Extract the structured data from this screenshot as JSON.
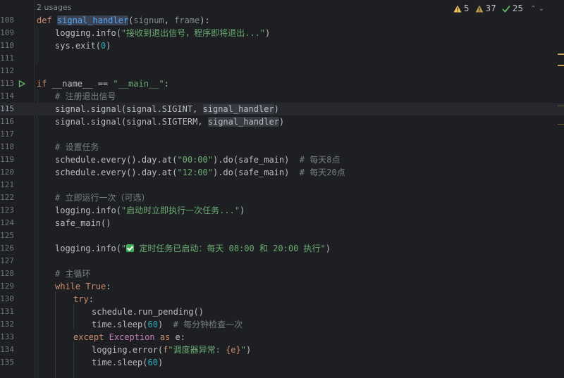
{
  "editor": {
    "usages": "2 usages",
    "inspections": {
      "warnings": "5",
      "weak_warnings": "37",
      "typos": "25"
    },
    "colors": {
      "background": "#1e1f22",
      "keyword": "#cf8e6d",
      "string": "#6aab73",
      "number": "#2aacb8",
      "comment": "#7a7e85",
      "function": "#56a8f5"
    },
    "line_numbers": [
      "108",
      "109",
      "110",
      "111",
      "112",
      "113",
      "114",
      "115",
      "116",
      "117",
      "118",
      "119",
      "120",
      "121",
      "122",
      "123",
      "124",
      "125",
      "126",
      "127",
      "128",
      "129",
      "130",
      "131",
      "132",
      "133",
      "134",
      "135"
    ],
    "current_line": "115",
    "code": {
      "l108": {
        "kw": "def",
        "name": "signal_handler",
        "open": "(",
        "p1": "signum",
        "comma": ", ",
        "p2": "frame",
        "close": "):"
      },
      "l109": {
        "pre": "logging.info(",
        "str": "\"接收到退出信号，程序即将退出...\"",
        "post": ")"
      },
      "l110": {
        "pre": "sys.exit(",
        "num": "0",
        "post": ")"
      },
      "l113": {
        "kw": "if",
        "mid": " __name__ == ",
        "str": "\"__main__\"",
        "post": ":"
      },
      "l114": {
        "cmt": "# 注册退出信号"
      },
      "l115": {
        "pre": "signal.signal(signal.SIGINT, ",
        "ref": "signal_handler",
        "post": ")"
      },
      "l116": {
        "pre": "signal.signal(signal.SIGTERM, ",
        "ref": "signal_handler",
        "post": ")"
      },
      "l118": {
        "cmt": "# 设置任务"
      },
      "l119": {
        "pre": "schedule.every().day.at(",
        "str": "\"00:00\"",
        "post": ").do(safe_main)  ",
        "cmt": "# 每天8点"
      },
      "l120": {
        "pre": "schedule.every().day.at(",
        "str": "\"12:00\"",
        "post": ").do(safe_main)  ",
        "cmt": "# 每天20点"
      },
      "l122": {
        "cmt": "# 立即运行一次（可选）"
      },
      "l123": {
        "pre": "logging.info(",
        "str": "\"启动时立即执行一次任务...\"",
        "post": ")"
      },
      "l124": {
        "pre": "safe_main()"
      },
      "l126": {
        "pre": "logging.info(",
        "str_a": "\"",
        "str_b": " 定时任务已启动：每天 08:00 和 20:00 执行\"",
        "post": ")"
      },
      "l128": {
        "cmt": "# 主循环"
      },
      "l129": {
        "kw": "while",
        "sp": " ",
        "kw2": "True",
        "post": ":"
      },
      "l130": {
        "kw": "try",
        "post": ":"
      },
      "l131": {
        "pre": "schedule.run_pending()"
      },
      "l132": {
        "pre": "time.sleep(",
        "num": "60",
        "post": ")  ",
        "cmt": "# 每分钟检查一次"
      },
      "l133": {
        "kw": "except",
        "sp": " ",
        "cls": "Exception",
        "sp2": " ",
        "kw2": "as",
        "post": " e:"
      },
      "l134": {
        "pre": "logging.error(",
        "fpre": "f",
        "str_a": "\"调度器异常: ",
        "brace": "{e}",
        "str_b": "\"",
        "post": ")"
      },
      "l135": {
        "pre": "time.sleep(",
        "num": "60",
        "post": ")"
      }
    }
  }
}
